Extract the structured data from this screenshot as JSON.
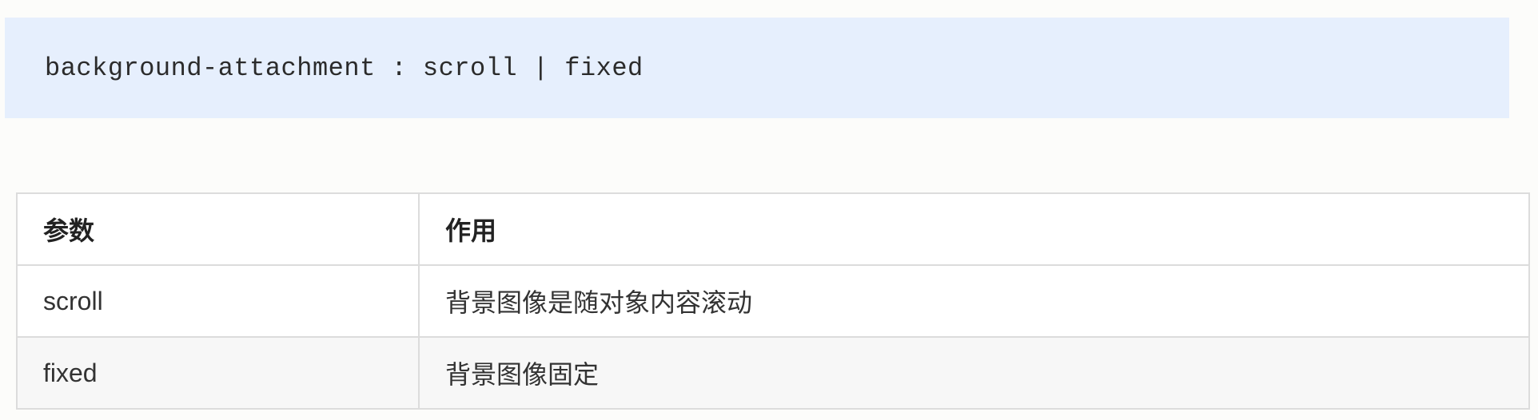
{
  "code": {
    "syntax": "background-attachment : scroll | fixed"
  },
  "table": {
    "headers": [
      "参数",
      "作用"
    ],
    "rows": [
      [
        "scroll",
        "背景图像是随对象内容滚动"
      ],
      [
        "fixed",
        "背景图像固定"
      ]
    ]
  },
  "colors": {
    "code_background": "#e6effd",
    "table_border": "#dcdcdc",
    "alt_row_background": "#f7f7f7"
  }
}
